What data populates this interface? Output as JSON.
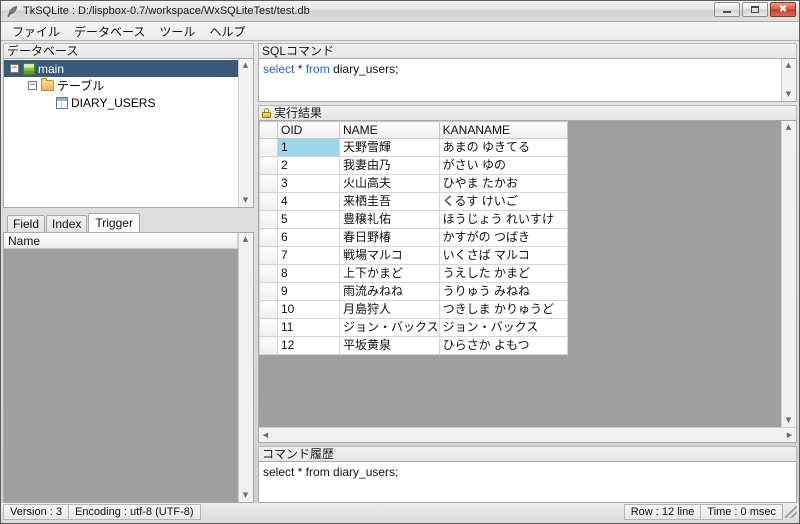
{
  "window": {
    "title": "TkSQLite : D:/lispbox-0.7/workspace/WxSQLiteTest/test.db",
    "app_icon": "feather-icon",
    "buttons": {
      "minimize": "minimize-icon",
      "maximize": "maximize-icon",
      "close": "close-icon"
    }
  },
  "menubar": {
    "items": [
      {
        "label": "ファイル"
      },
      {
        "label": "データベース"
      },
      {
        "label": "ツール"
      },
      {
        "label": "ヘルプ"
      }
    ]
  },
  "database_panel": {
    "title": "データベース",
    "tree": [
      {
        "label": "main",
        "icon": "database-icon",
        "expander": "−",
        "selected": true,
        "indent": 0
      },
      {
        "label": "テーブル",
        "icon": "folder-icon",
        "expander": "−",
        "selected": false,
        "indent": 1
      },
      {
        "label": "DIARY_USERS",
        "icon": "table-icon",
        "expander": "",
        "selected": false,
        "indent": 2
      }
    ]
  },
  "object_tabs": {
    "tabs": [
      {
        "label": "Field",
        "active": false
      },
      {
        "label": "Index",
        "active": false
      },
      {
        "label": "Trigger",
        "active": true
      }
    ],
    "list_header": "Name",
    "rows": []
  },
  "sql_panel": {
    "title": "SQLコマンド",
    "statement": {
      "keyword1": "select",
      "star": "*",
      "keyword2": "from",
      "rest": "diary_users;"
    }
  },
  "result_panel": {
    "title": "実行結果",
    "icon": "lock-icon",
    "columns": [
      "OID",
      "NAME",
      "KANANAME"
    ],
    "rows": [
      {
        "oid": "1",
        "name": "天野雪輝",
        "kana": "あまの ゆきてる"
      },
      {
        "oid": "2",
        "name": "我妻由乃",
        "kana": "がさい ゆの"
      },
      {
        "oid": "3",
        "name": "火山高夫",
        "kana": "ひやま たかお"
      },
      {
        "oid": "4",
        "name": "来栖圭吾",
        "kana": "くるす けいご"
      },
      {
        "oid": "5",
        "name": "豊穣礼佑",
        "kana": "ほうじょう れいすけ"
      },
      {
        "oid": "6",
        "name": "春日野椿",
        "kana": "かすがの つばき"
      },
      {
        "oid": "7",
        "name": "戦場マルコ",
        "kana": "いくさば マルコ"
      },
      {
        "oid": "8",
        "name": "上下かまど",
        "kana": "うえした かまど"
      },
      {
        "oid": "9",
        "name": "雨流みねね",
        "kana": "うりゅう みねね"
      },
      {
        "oid": "10",
        "name": "月島狩人",
        "kana": "つきしま かりゅうど"
      },
      {
        "oid": "11",
        "name": "ジョン・バックス",
        "kana": "ジョン・バックス"
      },
      {
        "oid": "12",
        "name": "平坂黄泉",
        "kana": "ひらさか よもつ"
      }
    ],
    "selected_cell": {
      "row": 0,
      "column": "oid"
    }
  },
  "history_panel": {
    "title": "コマンド履歴",
    "entries": [
      "select * from diary_users;"
    ]
  },
  "statusbar": {
    "version": "Version : 3",
    "encoding": "Encoding : utf-8 (UTF-8)",
    "row": "Row : 12 line",
    "time": "Time : 0 msec"
  },
  "colors": {
    "tree_selection": "#3a5a77",
    "cell_selection": "#9fd6e8",
    "sql_keyword": "#2b5fd9",
    "result_background": "#9e9e9e",
    "close_button": "#c33f28"
  },
  "scroll": {
    "up_arrow": "▲",
    "down_arrow": "▼",
    "left_arrow": "◀",
    "right_arrow": "▶"
  }
}
